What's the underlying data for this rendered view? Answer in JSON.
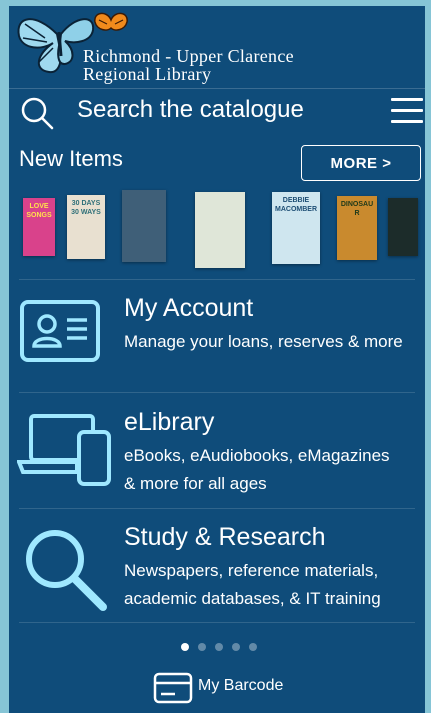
{
  "header": {
    "library_name_line1": "Richmond - Upper Clarence",
    "library_name_line2": "Regional Library",
    "logo_icon": "butterfly-logo"
  },
  "search": {
    "placeholder": "Search the catalogue",
    "icon": "search-icon",
    "menu_icon": "hamburger-menu-icon"
  },
  "new_items": {
    "title": "New Items",
    "more_label": "MORE >",
    "covers": [
      {
        "text": "LOVE SONGS",
        "bg": "#d9428b",
        "fg": "#ffe24d"
      },
      {
        "text": "30 DAYS 30 WAYS",
        "bg": "#e8e0d0",
        "fg": "#2e6f78"
      },
      {
        "text": "",
        "bg": "#3f5f78",
        "fg": "#ffffff"
      },
      {
        "text": "",
        "bg": "#dfe6d8",
        "fg": "#334"
      },
      {
        "text": "DEBBIE MACOMBER",
        "bg": "#cfe6ef",
        "fg": "#1d4e74"
      },
      {
        "text": "DINOSAUR",
        "bg": "#c98a2e",
        "fg": "#203a1a"
      },
      {
        "text": "",
        "bg": "#1c2c2a",
        "fg": "#f0c040"
      }
    ]
  },
  "menu": [
    {
      "title": "My Account",
      "desc_line1": "Manage your loans, reserves & more",
      "desc_line2": "",
      "icon": "id-card-icon"
    },
    {
      "title": "eLibrary",
      "desc_line1": "eBooks, eAudiobooks, eMagazines",
      "desc_line2": "& more for all ages",
      "icon": "laptop-phone-icon"
    },
    {
      "title": "Study & Research",
      "desc_line1": "Newspapers, reference materials,",
      "desc_line2": "academic databases, & IT training",
      "icon": "magnifier-icon"
    }
  ],
  "pager": {
    "total": 5,
    "active": 0
  },
  "footer": {
    "barcode_label": "My Barcode",
    "barcode_icon": "barcode-card-icon"
  },
  "colors": {
    "background": "#0f4c7a",
    "accent": "#9fe8ff",
    "frame": "#86c5d6"
  }
}
